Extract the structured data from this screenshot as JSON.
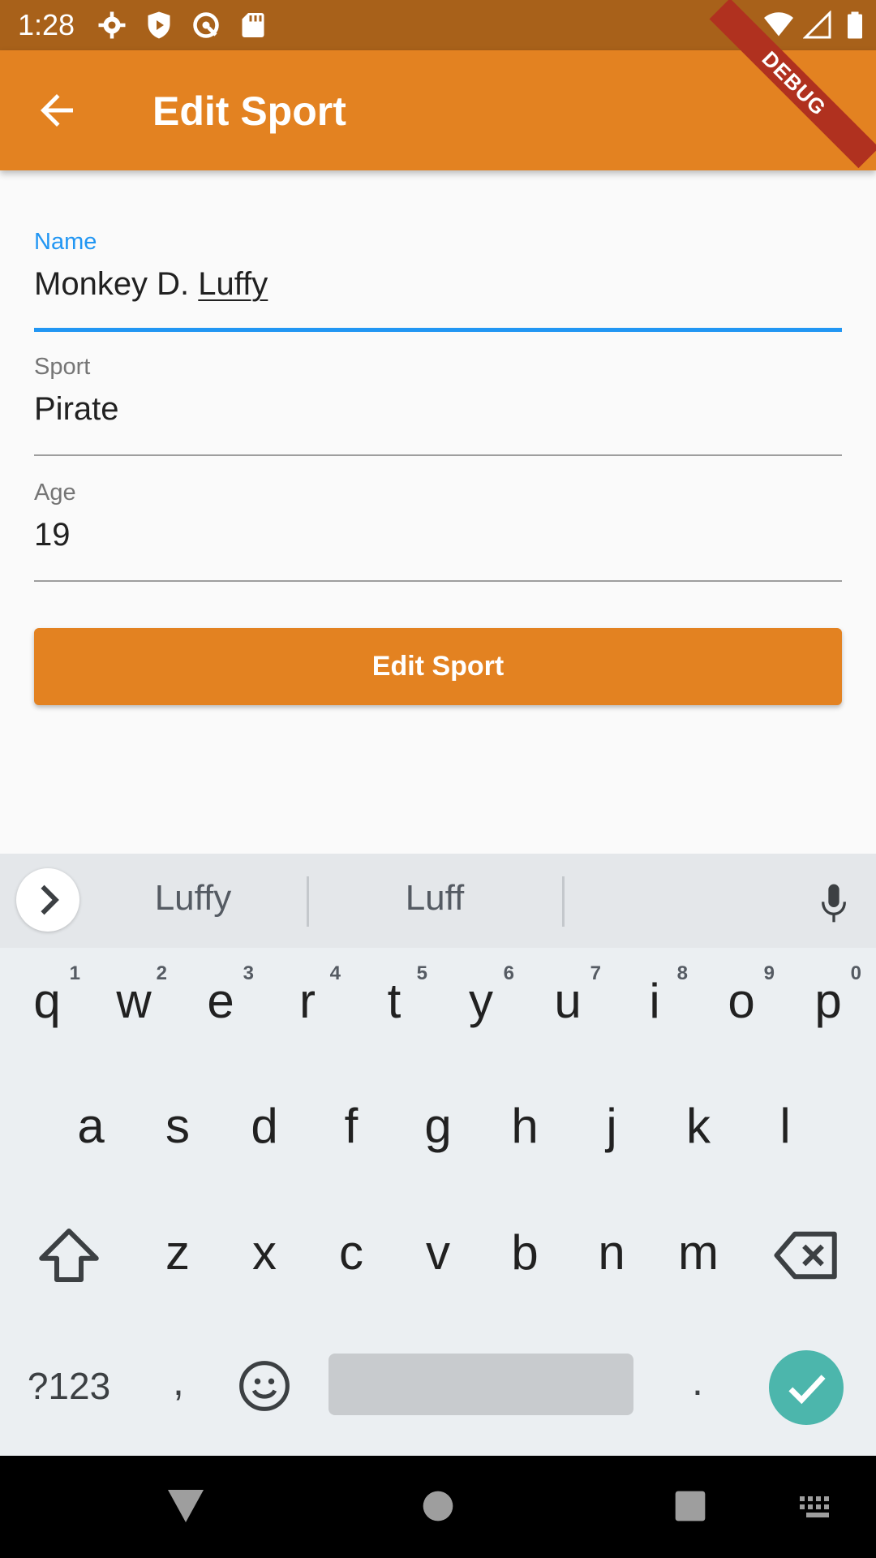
{
  "status_bar": {
    "time": "1:28",
    "icons": [
      "settings-icon",
      "shield-icon",
      "circle-slash-icon",
      "sd-card-icon",
      "wifi-icon",
      "signal-icon",
      "battery-icon"
    ]
  },
  "app_bar": {
    "title": "Edit Sport",
    "back_icon": "arrow-back-icon",
    "color": "#e38221",
    "debug_banner": "DEBUG"
  },
  "form": {
    "name": {
      "label": "Name",
      "value_first": "Monkey D. ",
      "value_last": "Luffy",
      "focused": true
    },
    "sport": {
      "label": "Sport",
      "value": "Pirate"
    },
    "age": {
      "label": "Age",
      "value": "19"
    },
    "submit_label": "Edit Sport"
  },
  "keyboard": {
    "suggestions": [
      "Luffy",
      "Luff"
    ],
    "row1": [
      {
        "char": "q",
        "hint": "1"
      },
      {
        "char": "w",
        "hint": "2"
      },
      {
        "char": "e",
        "hint": "3"
      },
      {
        "char": "r",
        "hint": "4"
      },
      {
        "char": "t",
        "hint": "5"
      },
      {
        "char": "y",
        "hint": "6"
      },
      {
        "char": "u",
        "hint": "7"
      },
      {
        "char": "i",
        "hint": "8"
      },
      {
        "char": "o",
        "hint": "9"
      },
      {
        "char": "p",
        "hint": "0"
      }
    ],
    "row2": [
      "a",
      "s",
      "d",
      "f",
      "g",
      "h",
      "j",
      "k",
      "l"
    ],
    "row3": [
      "z",
      "x",
      "c",
      "v",
      "b",
      "n",
      "m"
    ],
    "symbols_label": "?123",
    "comma": ",",
    "period": ".",
    "accent_color": "#4cb6ac"
  },
  "nav_bar": {
    "icons": [
      "back-triangle-icon",
      "home-circle-icon",
      "recents-square-icon",
      "keyboard-icon"
    ]
  }
}
